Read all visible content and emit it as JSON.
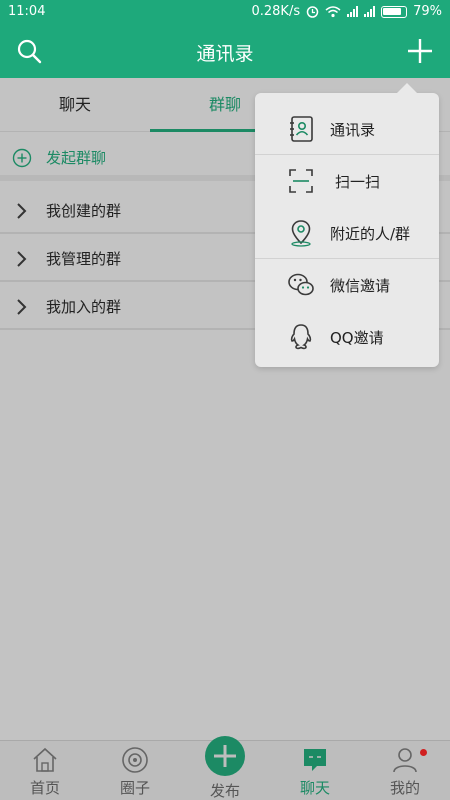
{
  "status": {
    "time": "11:04",
    "speed": "0.28K/s",
    "battery": "79%"
  },
  "appbar": {
    "title": "通讯录"
  },
  "tabs": [
    {
      "label": "聊天"
    },
    {
      "label": "群聊"
    },
    {
      "label": ""
    }
  ],
  "start_group": {
    "label": "发起群聊"
  },
  "groups": [
    {
      "label": "我创建的群"
    },
    {
      "label": "我管理的群"
    },
    {
      "label": "我加入的群"
    }
  ],
  "popup": {
    "items": [
      {
        "label": "通讯录",
        "icon": "contacts-icon"
      },
      {
        "label": "扫一扫",
        "icon": "scan-icon"
      },
      {
        "label": "附近的人/群",
        "icon": "location-icon"
      },
      {
        "label": "微信邀请",
        "icon": "wechat-icon"
      },
      {
        "label": "QQ邀请",
        "icon": "qq-icon"
      }
    ]
  },
  "bottom": {
    "items": [
      {
        "label": "首页",
        "icon": "home-icon"
      },
      {
        "label": "圈子",
        "icon": "circle-icon"
      },
      {
        "label": "发布",
        "icon": "publish-icon"
      },
      {
        "label": "聊天",
        "icon": "chat-icon"
      },
      {
        "label": "我的",
        "icon": "profile-icon"
      }
    ]
  },
  "colors": {
    "accent": "#1ea97b",
    "accent_dark": "#1c8a64",
    "overlay": "#c3c3c3"
  }
}
